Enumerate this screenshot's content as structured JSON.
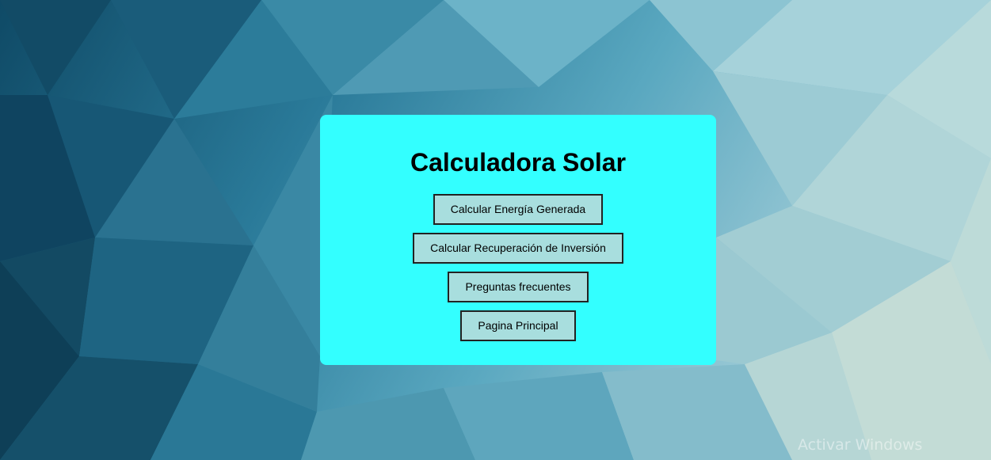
{
  "card": {
    "title": "Calculadora Solar",
    "buttons": [
      {
        "label": "Calcular Energía Generada"
      },
      {
        "label": "Calcular Recuperación de Inversión"
      },
      {
        "label": "Preguntas frecuentes"
      },
      {
        "label": "Pagina Principal"
      }
    ]
  },
  "watermark": "Activar Windows",
  "colors": {
    "card_bg": "#33ffff",
    "button_bg": "#a8dede",
    "button_border": "#222222"
  }
}
